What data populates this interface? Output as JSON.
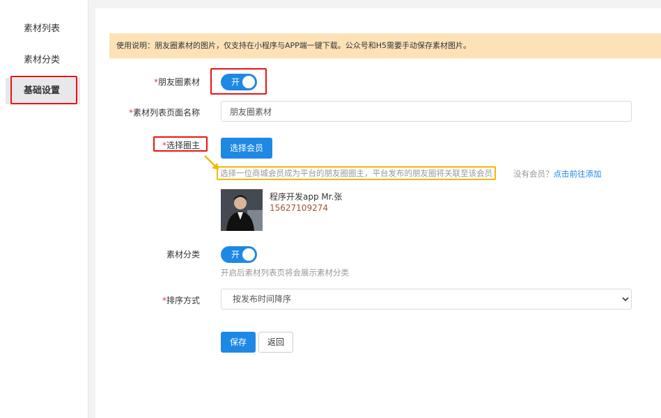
{
  "sidebar": {
    "items": [
      {
        "label": "素材列表"
      },
      {
        "label": "素材分类"
      },
      {
        "label": "基础设置"
      }
    ]
  },
  "notice": {
    "text": "使用说明：朋友圈素材的图片，仅支持在小程序与APP端一键下载。公众号和H5需要手动保存素材图片。"
  },
  "form": {
    "moments_material": {
      "label": "朋友圈素材",
      "toggle_text": "开"
    },
    "list_page_name": {
      "label": "素材列表页面名称",
      "value": "朋友圈素材"
    },
    "select_owner": {
      "label": "选择圈主",
      "button": "选择会员",
      "hint": "选择一位商城会员成为平台的朋友圈圈主，平台发布的朋友圈将关联至该会员",
      "no_member": "没有会员？",
      "add_link": "点击前往添加"
    },
    "member": {
      "name": "程序开发app Mr.张",
      "phone": "15627109274"
    },
    "category": {
      "label": "素材分类",
      "toggle_text": "开",
      "help": "开启后素材列表页将会展示素材分类"
    },
    "sort": {
      "label": "排序方式",
      "selected": "按发布时间降序"
    },
    "actions": {
      "save": "保存",
      "back": "返回"
    }
  },
  "colors": {
    "primary": "#1e88e5",
    "highlight_red": "#e11111",
    "highlight_yellow": "#f5b800",
    "notice_bg": "#fde2b8",
    "phone": "#a0522d"
  }
}
